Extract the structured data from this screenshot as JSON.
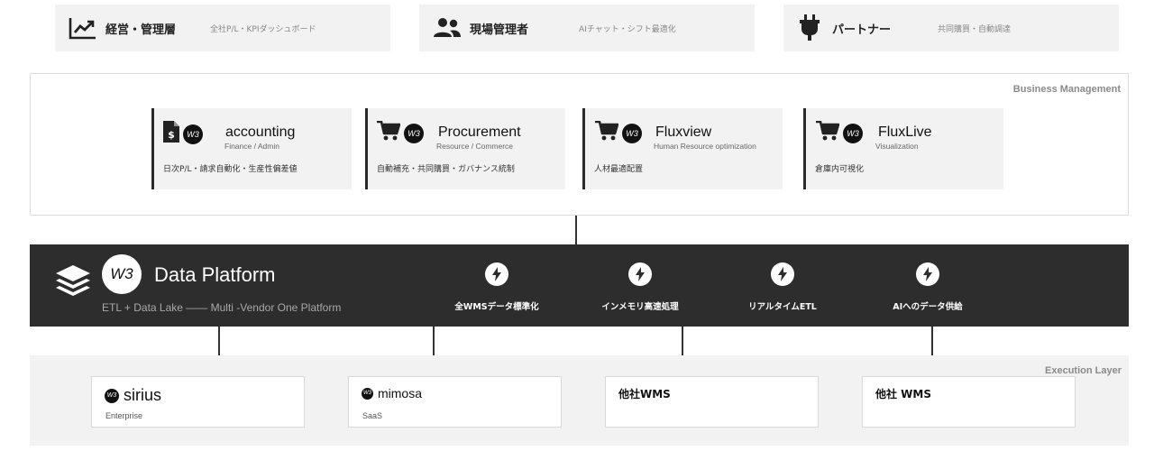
{
  "personas": [
    {
      "icon": "trend-chart-icon",
      "name": "経営・管理層",
      "desc": "全社P/L・KPIダッシュボード"
    },
    {
      "icon": "users-icon",
      "name": "現場管理者",
      "desc": "AIチャット・シフト最適化"
    },
    {
      "icon": "plug-icon",
      "name": "パートナー",
      "desc": "共同購買・自動調達"
    }
  ],
  "business": {
    "label": "Business Management",
    "cards": [
      {
        "icon": "invoice-icon",
        "logo": "W3",
        "title": "accounting",
        "subtitle": "Finance / Admin",
        "desc": "日次P/L・請求自動化・生産性偏差値"
      },
      {
        "icon": "cart-icon",
        "logo": "W3",
        "title": "Procurement",
        "subtitle": "Resource / Commerce",
        "desc": "自動補充・共同購買・ガバナンス統制"
      },
      {
        "icon": "cart-icon",
        "logo": "W3",
        "title": "Fluxview",
        "subtitle": "Human Resource optimization",
        "desc": "人材最適配置"
      },
      {
        "icon": "cart-icon",
        "logo": "W3",
        "title": "FluxLive",
        "subtitle": "Visualization",
        "desc": "倉庫内可視化"
      }
    ]
  },
  "platform": {
    "logo": "W3",
    "title": "Data Platform",
    "subtitle": "ETL + Data Lake —— Multi -Vendor One Platform",
    "features": [
      {
        "icon": "bolt-icon",
        "label": "全WMSデータ標準化"
      },
      {
        "icon": "bolt-icon",
        "label": "インメモリ高速処理"
      },
      {
        "icon": "bolt-icon",
        "label": "リアルタイムETL"
      },
      {
        "icon": "bolt-icon",
        "label": "AIへのデータ供給"
      }
    ]
  },
  "execution": {
    "label": "Execution Layer",
    "cards": [
      {
        "logo": "W3",
        "title": "sirius",
        "subtitle": "Enterprise"
      },
      {
        "logo": "W3",
        "title": "mimosa",
        "subtitle": "SaaS"
      },
      {
        "logo": "",
        "title": "他社WMS",
        "subtitle": ""
      },
      {
        "logo": "",
        "title": "他社 WMS",
        "subtitle": ""
      }
    ]
  }
}
